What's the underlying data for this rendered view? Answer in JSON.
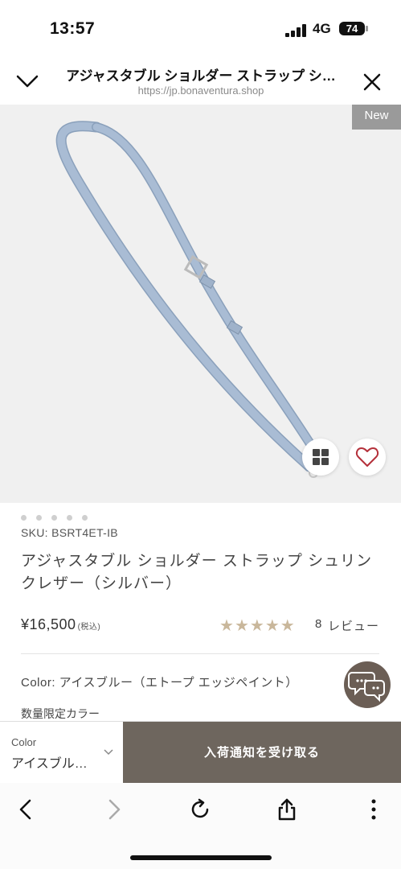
{
  "status_bar": {
    "time": "13:57",
    "network": "4G",
    "battery": "74"
  },
  "nav": {
    "title": "アジャスタブル ショルダー ストラップ シ…",
    "url": "https://jp.bonaventura.shop"
  },
  "image": {
    "badge": "New"
  },
  "product": {
    "sku": "SKU: BSRT4ET-IB",
    "name": "アジャスタブル ショルダー ストラップ シュリンクレザー（シルバー）",
    "price": "¥16,500",
    "tax_label": "(税込)",
    "rating_stars": 5,
    "review_count": "8",
    "review_label": "レビュー",
    "color_line": "Color: アイスブルー（エトープ エッジペイント）",
    "limited_label": "数量限定カラー"
  },
  "bottom_bar": {
    "color_label": "Color",
    "color_value": "アイスブル…",
    "notify_label": "入荷通知を受け取る"
  },
  "colors": {
    "accent_brown": "#6e665e",
    "star": "#c9b79b",
    "heart": "#b4303a",
    "strap": "#a9bcd4"
  }
}
